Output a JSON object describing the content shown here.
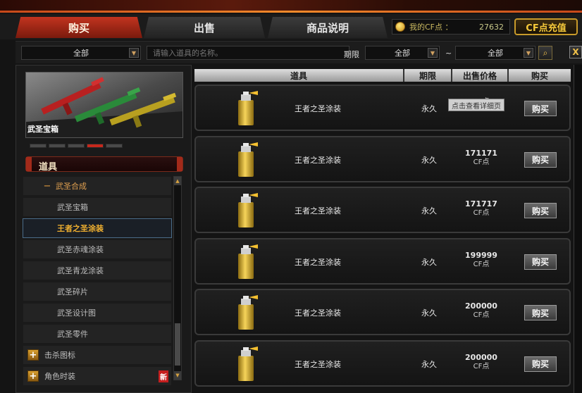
{
  "tabs": {
    "buy": "购买",
    "sell": "出售",
    "description": "商品说明"
  },
  "account": {
    "cf_label": "我的CF点 ：",
    "cf_value": "27632",
    "recharge_label": "CF点充值"
  },
  "filter": {
    "category_value": "全部",
    "search_placeholder": "请输入道具的名称。",
    "period_label": "期限",
    "period_from": "全部",
    "tilde": "~",
    "period_to": "全部",
    "close_label": "X"
  },
  "promo": {
    "title": "武圣宝箱",
    "pager_active_index": 3,
    "pager_count": 5
  },
  "sidebar": {
    "section_title": "道具",
    "items": [
      {
        "label": "武圣合成",
        "kind": "expanded-parent",
        "sign": "−"
      },
      {
        "label": "武圣宝箱",
        "kind": "child"
      },
      {
        "label": "王者之圣涂装",
        "kind": "child-selected"
      },
      {
        "label": "武圣赤魂涂装",
        "kind": "child"
      },
      {
        "label": "武圣青龙涂装",
        "kind": "child"
      },
      {
        "label": "武圣碎片",
        "kind": "child"
      },
      {
        "label": "武圣设计图",
        "kind": "child"
      },
      {
        "label": "武圣零件",
        "kind": "child"
      },
      {
        "label": "击杀图标",
        "kind": "category",
        "sign": "+"
      },
      {
        "label": "角色时装",
        "kind": "category",
        "sign": "+",
        "badge": "新"
      }
    ]
  },
  "table": {
    "headers": [
      "道具",
      "期限",
      "出售价格",
      "购买"
    ],
    "rows": [
      {
        "name": "王者之圣涂装",
        "period": "永久",
        "price": "",
        "unit": "CF点",
        "buy": "购买"
      },
      {
        "name": "王者之圣涂装",
        "period": "永久",
        "price": "171171",
        "unit": "CF点",
        "buy": "购买"
      },
      {
        "name": "王者之圣涂装",
        "period": "永久",
        "price": "171717",
        "unit": "CF点",
        "buy": "购买"
      },
      {
        "name": "王者之圣涂装",
        "period": "永久",
        "price": "199999",
        "unit": "CF点",
        "buy": "购买"
      },
      {
        "name": "王者之圣涂装",
        "period": "永久",
        "price": "200000",
        "unit": "CF点",
        "buy": "购买"
      },
      {
        "name": "王者之圣涂装",
        "period": "永久",
        "price": "200000",
        "unit": "CF点",
        "buy": "购买"
      }
    ],
    "tooltip": "点击查看详细页"
  },
  "colors": {
    "accent_red": "#c2341f",
    "gold": "#f6c93a",
    "selected_text": "#f0b030"
  }
}
